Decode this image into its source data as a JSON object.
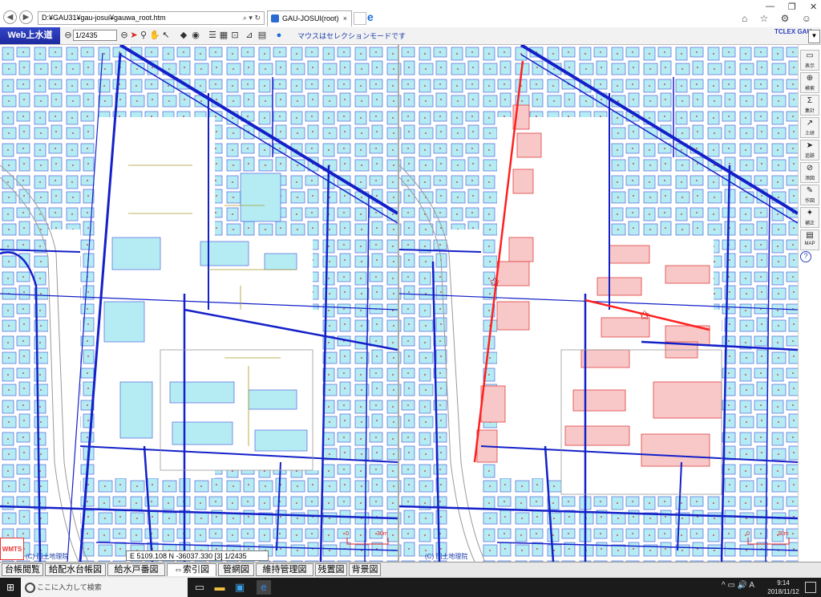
{
  "browser": {
    "address": "D:¥GAU31¥gau-josui¥gauwa_root.htm",
    "address_icons": "⌕ ▾ ↻",
    "tab_title": "GAU-JOSUI(root)",
    "tab_close": "×",
    "window_controls": {
      "minimize": "—",
      "maximize": "❐",
      "close": "✕"
    },
    "right_icons": "⌂ ☆ ⚙ ☺"
  },
  "toolbar": {
    "app_logo": "Web上水道",
    "scale_value": "1/2435",
    "message": "マウスはセレクションモードです",
    "brand": "TCLEX GAU",
    "icons": [
      "zoom-out-icon",
      "zoom-box-icon",
      "cursor-select-icon",
      "zoom-in-icon",
      "pan-hand-icon",
      "cursor-icon",
      "layers-icon",
      "globe-small-icon",
      "list-icon",
      "grid-icon",
      "zoom-fit-icon",
      "chart-icon",
      "table-icon",
      "globe-icon"
    ]
  },
  "side_panel": [
    {
      "icon": "display-icon",
      "glyph": "▭",
      "label": "表示"
    },
    {
      "icon": "search-icon",
      "glyph": "⊕",
      "label": "検索"
    },
    {
      "icon": "sum-icon",
      "glyph": "Σ",
      "label": "集計"
    },
    {
      "icon": "cross-section-icon",
      "glyph": "↗",
      "label": "土研"
    },
    {
      "icon": "trace-icon",
      "glyph": "➤",
      "label": "追跡"
    },
    {
      "icon": "clip-icon",
      "glyph": "⊘",
      "label": "添図"
    },
    {
      "icon": "pen-icon",
      "glyph": "✎",
      "label": "作図"
    },
    {
      "icon": "correction-icon",
      "glyph": "✦",
      "label": "補正"
    },
    {
      "icon": "map-folder-icon",
      "glyph": "▤",
      "label": "MAP"
    }
  ],
  "help": "?",
  "map": {
    "wmts": "WMTS",
    "copyright_left": "(C) 国土地理院",
    "copyright_right": "(C) 国土地理院",
    "coordinate_readout": "E 5109.108 N -36037.330 [3] 1/2435",
    "scale_label_0": "0",
    "scale_label_30": "30m"
  },
  "bottom_tabs": [
    {
      "label": "台帳閲覧",
      "active": false
    },
    {
      "label": "給配水台帳図",
      "active": false
    },
    {
      "label": "給水戸番図",
      "active": false
    },
    {
      "label": "⇔索引図",
      "active": true
    },
    {
      "label": "管網図",
      "active": false
    },
    {
      "label": "維持管理図",
      "active": false
    },
    {
      "label": "残置図",
      "active": false
    },
    {
      "label": "背景図",
      "active": false
    }
  ],
  "taskbar": {
    "search_placeholder": "ここに入力して検索",
    "time": "9:14",
    "date": "2018/11/12",
    "tray_glyphs": "^ ▭ 🔊 A"
  },
  "colors": {
    "pipe": "#1420c8",
    "building": "#b5ecf4",
    "selected": "#ff3030",
    "selected_fill": "#f8c8c8"
  }
}
